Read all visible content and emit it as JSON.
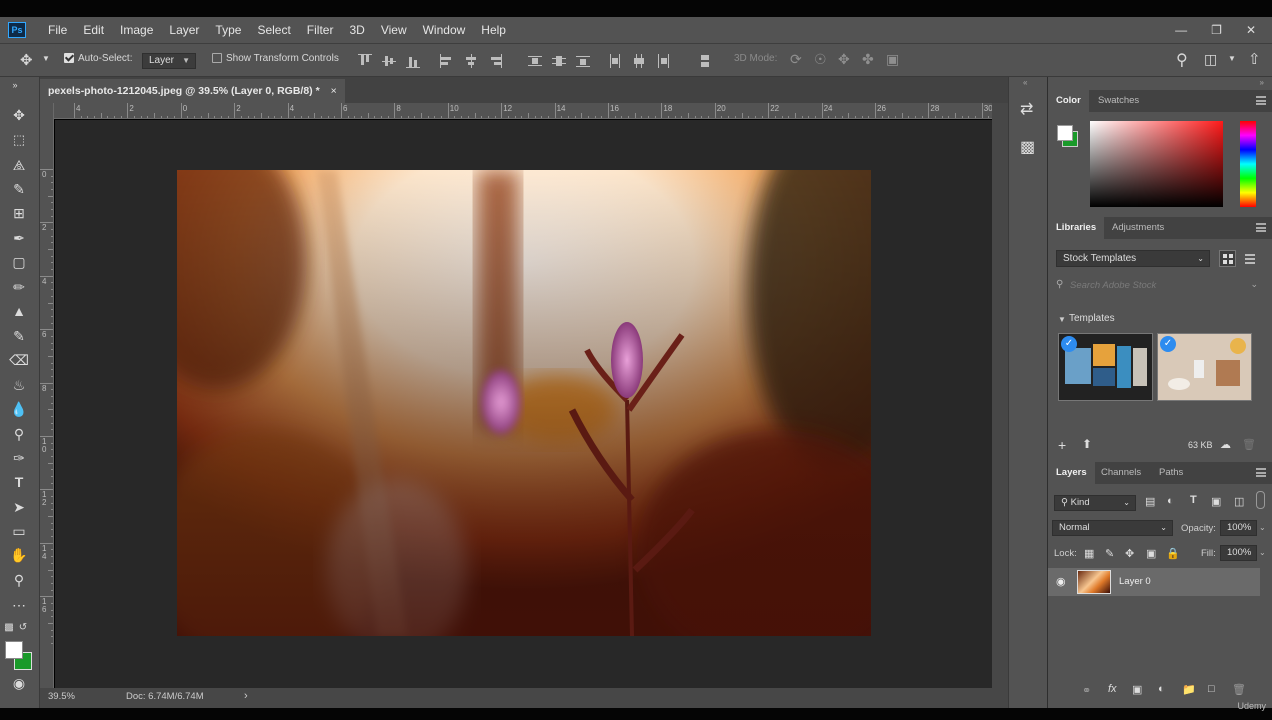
{
  "app": {
    "logo": "Ps"
  },
  "menu": [
    "File",
    "Edit",
    "Image",
    "Layer",
    "Type",
    "Select",
    "Filter",
    "3D",
    "View",
    "Window",
    "Help"
  ],
  "options": {
    "auto_select_label": "Auto-Select:",
    "auto_select_value": "Layer",
    "show_transform_label": "Show Transform Controls",
    "mode_3d_label": "3D Mode:"
  },
  "document": {
    "tab_title": "pexels-photo-1212045.jpeg @ 39.5% (Layer 0, RGB/8) *",
    "tab_close": "×",
    "h_ruler": [
      "4",
      "2",
      "0",
      "2",
      "4",
      "6",
      "8",
      "10",
      "12",
      "14",
      "16",
      "18",
      "20",
      "22",
      "24",
      "26",
      "28",
      "30"
    ],
    "v_ruler": [
      "0",
      "2",
      "4",
      "6",
      "8",
      "1\n0",
      "1\n2",
      "1\n4",
      "1\n6"
    ],
    "zoom": "39.5%",
    "doc_size": "Doc: 6.74M/6.74M"
  },
  "color_panel": {
    "tabs": [
      "Color",
      "Swatches"
    ],
    "foreground": "#ffffff",
    "background": "#1a9a2a",
    "picker_hue": "#ff1a1a"
  },
  "libraries_panel": {
    "tabs": [
      "Libraries",
      "Adjustments"
    ],
    "library_select": "Stock Templates",
    "search_placeholder": "Search Adobe Stock",
    "section_title": "Templates",
    "storage": "63 KB"
  },
  "layers_panel": {
    "tabs": [
      "Layers",
      "Channels",
      "Paths"
    ],
    "filter_label": "Kind",
    "blend_mode": "Normal",
    "opacity_label": "Opacity:",
    "opacity_value": "100%",
    "lock_label": "Lock:",
    "fill_label": "Fill:",
    "fill_value": "100%",
    "layers": [
      {
        "name": "Layer 0",
        "visible": true
      }
    ]
  },
  "watermark": "Udemy"
}
